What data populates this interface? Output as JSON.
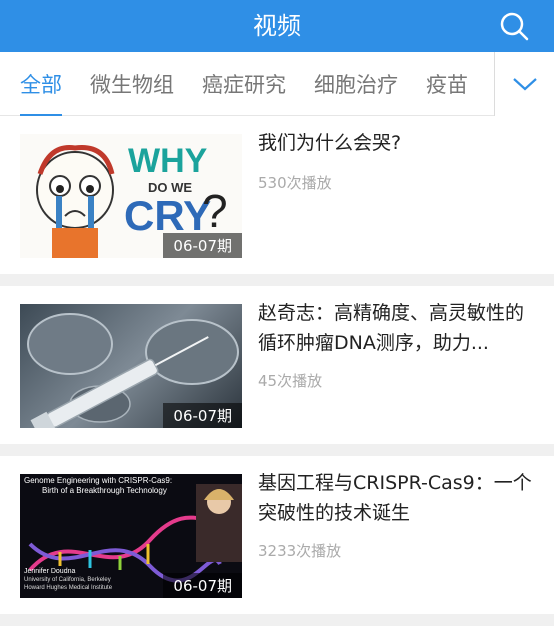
{
  "header": {
    "title": "视频"
  },
  "tabs": [
    "全部",
    "微生物组",
    "癌症研究",
    "细胞治疗",
    "疫苗"
  ],
  "videos": [
    {
      "title": "我们为什么会哭?",
      "plays": "530次播放",
      "issue": "06-07期",
      "thumb_text": {
        "why": "WHY",
        "do_we": "DO WE",
        "cry": "CRY",
        "q": "?"
      }
    },
    {
      "title": "赵奇志：高精确度、高灵敏性的循环肿瘤DNA测序，助力...",
      "plays": "45次播放",
      "issue": "06-07期"
    },
    {
      "title": "基因工程与CRISPR-Cas9：一个突破性的技术诞生",
      "plays": "3233次播放",
      "issue": "06-07期",
      "thumb_text": {
        "line1": "Genome Engineering with CRISPR-Cas9:",
        "line2": "Birth of a Breakthrough Technology",
        "name": "Jennifer Doudna",
        "aff1": "University of California, Berkeley",
        "aff2": "Howard Hughes Medical Institute"
      }
    }
  ]
}
